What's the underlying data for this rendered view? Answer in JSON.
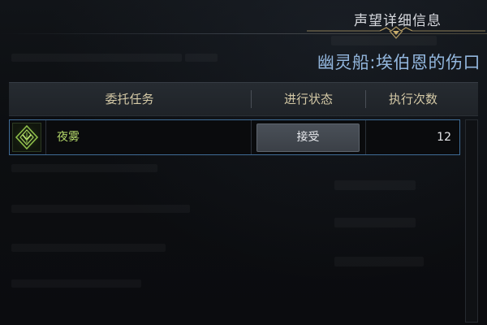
{
  "panel": {
    "title": "声望详细信息",
    "faction_title": "幽灵船:埃伯恩的伤口"
  },
  "table": {
    "columns": [
      "委托任务",
      "进行状态",
      "执行次数"
    ],
    "rows": [
      {
        "icon": "faction-emblem-icon",
        "name": "夜雾",
        "status_button": "接受",
        "count": "12"
      }
    ]
  },
  "colors": {
    "accent_blue": "#93b7de",
    "header_text": "#d4c9a6",
    "quest_name_green": "#b4d86a",
    "row_border": "#3f6c96"
  }
}
